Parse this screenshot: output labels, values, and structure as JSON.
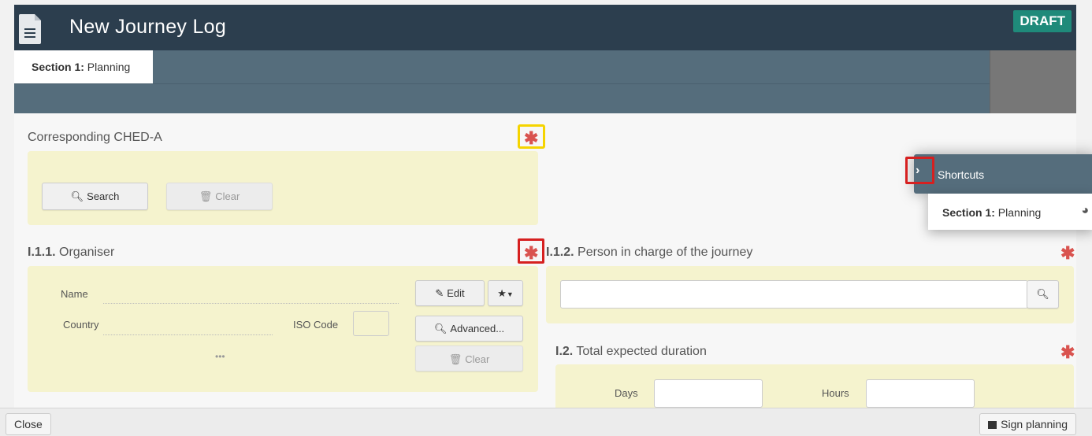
{
  "header": {
    "title": "New Journey Log",
    "badge": "DRAFT"
  },
  "tabs": [
    {
      "bold": "Section 1:",
      "label": " Planning"
    }
  ],
  "ched": {
    "title": "Corresponding CHED-A",
    "search_label": "Search",
    "clear_label": "Clear"
  },
  "organiser": {
    "number": "I.1.1.",
    "title": "Organiser",
    "name_label": "Name",
    "country_label": "Country",
    "iso_label": "ISO Code",
    "more": "•••",
    "edit_label": "Edit",
    "advanced_label": "Advanced...",
    "clear_label": "Clear"
  },
  "person": {
    "number": "I.1.2.",
    "title": "Person in charge of the journey",
    "search_value": ""
  },
  "duration": {
    "number": "I.2.",
    "title": "Total expected duration",
    "days_label": "Days",
    "hours_label": "Hours",
    "days_value": "",
    "hours_value": ""
  },
  "shortcuts": {
    "label": "Shortcuts",
    "items": [
      {
        "bold": "Section 1:",
        "label": " Planning"
      }
    ]
  },
  "footer": {
    "close_label": "Close",
    "sign_label": "Sign planning"
  },
  "required_mark": "✱",
  "colors": {
    "header": "#2c3e4e",
    "badge": "#1f8a7a",
    "panel": "#f5f3ce",
    "required": "#d9534f"
  }
}
